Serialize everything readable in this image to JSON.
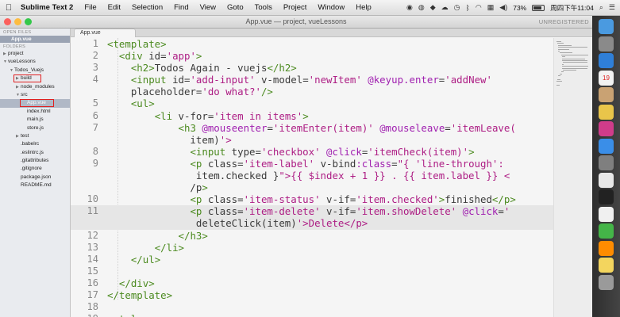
{
  "menubar": {
    "app_name": "Sublime Text 2",
    "menus": [
      "File",
      "Edit",
      "Selection",
      "Find",
      "View",
      "Goto",
      "Tools",
      "Project",
      "Window",
      "Help"
    ],
    "battery": "73%",
    "clock": "周四下午11:04"
  },
  "window": {
    "title": "App.vue — project, vueLessons",
    "unregistered": "UNREGISTERED"
  },
  "sidebar": {
    "open_files_header": "OPEN FILES",
    "open_file": "App.vue",
    "folders_header": "FOLDERS",
    "items": [
      {
        "label": "project",
        "depth": 0,
        "expander": "closed"
      },
      {
        "label": "vueLessons",
        "depth": 0,
        "expander": "open"
      },
      {
        "label": "Todos_Vuejs",
        "depth": 1,
        "expander": "open"
      },
      {
        "label": "build",
        "depth": 2,
        "expander": "closed",
        "boxed": true
      },
      {
        "label": "node_modules",
        "depth": 2,
        "expander": "closed"
      },
      {
        "label": "src",
        "depth": 2,
        "expander": "open"
      },
      {
        "label": "App.vue",
        "depth": 3,
        "expander": "none",
        "selected": true,
        "boxed": true
      },
      {
        "label": "index.html",
        "depth": 3,
        "expander": "none"
      },
      {
        "label": "main.js",
        "depth": 3,
        "expander": "none"
      },
      {
        "label": "store.js",
        "depth": 3,
        "expander": "none"
      },
      {
        "label": "test",
        "depth": 2,
        "expander": "closed"
      },
      {
        "label": ".babelrc",
        "depth": 2,
        "expander": "none"
      },
      {
        "label": ".eslintrc.js",
        "depth": 2,
        "expander": "none"
      },
      {
        "label": ".gitattributes",
        "depth": 2,
        "expander": "none"
      },
      {
        "label": ".gitignore",
        "depth": 2,
        "expander": "none"
      },
      {
        "label": "package.json",
        "depth": 2,
        "expander": "none"
      },
      {
        "label": "README.md",
        "depth": 2,
        "expander": "none"
      }
    ]
  },
  "editor": {
    "tab_label": "App.vue",
    "current_line": 11,
    "lines": [
      {
        "num": "1",
        "code": "<template>"
      },
      {
        "num": "2",
        "code": "  <div id='app'>"
      },
      {
        "num": "3",
        "code": "    <h2>Todos Again - vuejs</h2>"
      },
      {
        "num": "4",
        "code": "    <input id='add-input' v-model='newItem' @keyup.enter='addNew'"
      },
      {
        "num": "",
        "code": "    placeholder='do what?'/>"
      },
      {
        "num": "5",
        "code": "    <ul>"
      },
      {
        "num": "6",
        "code": "        <li v-for='item in items'>"
      },
      {
        "num": "7",
        "code": "            <h3 @mouseenter='itemEnter(item)' @mouseleave='itemLeave("
      },
      {
        "num": "",
        "code": "              item)'>"
      },
      {
        "num": "8",
        "code": "              <input type='checkbox' @click='itemCheck(item)'>"
      },
      {
        "num": "9",
        "code": "              <p class='item-label' v-bind:class=\"{ 'line-through':"
      },
      {
        "num": "",
        "code": "               item.checked }\">{{ $index + 1 }} . {{ item.label }} <"
      },
      {
        "num": "",
        "code": "              /p>"
      },
      {
        "num": "10",
        "code": "              <p class='item-status' v-if='item.checked'>finished</p>"
      },
      {
        "num": "11",
        "code": "              <p class='item-delete' v-if='item.showDelete' @click='"
      },
      {
        "num": "",
        "code": "               deleteClick(item)'>Delete</p>"
      },
      {
        "num": "12",
        "code": "            </h3>"
      },
      {
        "num": "13",
        "code": "        </li>"
      },
      {
        "num": "14",
        "code": "    </ul>"
      },
      {
        "num": "15",
        "code": ""
      },
      {
        "num": "16",
        "code": "  </div>"
      },
      {
        "num": "17",
        "code": "</template>"
      },
      {
        "num": "18",
        "code": ""
      },
      {
        "num": "19",
        "code": "<style>"
      }
    ]
  },
  "dock": {
    "icons": [
      "finder-icon",
      "launchpad-icon",
      "safari-icon",
      "calendar-icon",
      "contacts-icon",
      "photos-icon",
      "itunes-icon",
      "appstore-icon",
      "preferences-icon",
      "chrome-icon",
      "terminal-icon",
      "qq-icon",
      "wechat-icon",
      "sublime-icon",
      "notes-icon",
      "trash-icon"
    ],
    "calendar_day": "19"
  }
}
